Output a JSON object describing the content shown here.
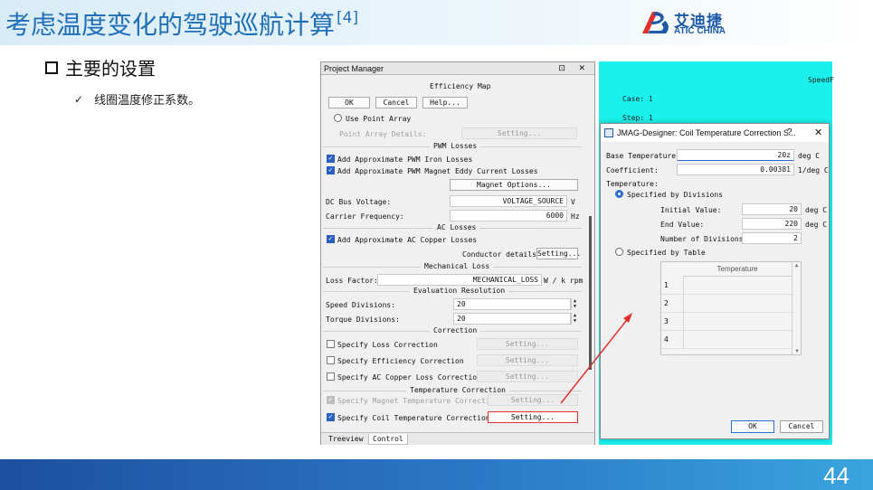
{
  "slide": {
    "title": "考虑温度变化的驾驶巡航计算",
    "title_ref": "[4]",
    "logo_cn": "艾迪捷",
    "logo_en": "ATIC CHINA",
    "heading": "主要的设置",
    "bullet": "线圈温度修正系数。",
    "page_number": "44"
  },
  "project_manager": {
    "title": "Project Manager",
    "window_controls": "⊡ ✕",
    "efficiency_map_label": "Efficiency Map",
    "ok": "OK",
    "cancel": "Cancel",
    "help": "Help...",
    "use_point_array": "Use Point Array",
    "point_array_details": "Point Array Details:",
    "setting": "Setting...",
    "pwm_losses": "PWM Losses",
    "pwm_iron": "Add Approximate PWM Iron Losses",
    "pwm_eddy": "Add Approximate PWM Magnet Eddy Current Losses",
    "magnet_options": "Magnet Options...",
    "dc_bus_label": "DC Bus Voltage:",
    "dc_bus_value": "VOLTAGE_SOURCE",
    "dc_bus_unit": "V",
    "carrier_label": "Carrier Frequency:",
    "carrier_value": "6000",
    "carrier_unit": "Hz",
    "ac_losses": "AC Losses",
    "ac_copper": "Add Approximate AC Copper Losses",
    "conductor_details": "Conductor details:",
    "mechanical_loss": "Mechanical Loss",
    "loss_factor_label": "Loss Factor:",
    "loss_factor_value": "MECHANICAL_LOSS",
    "loss_factor_unit": "W / k rpm",
    "eval_resolution": "Evaluation Resolution",
    "speed_div_label": "Speed Divisions:",
    "speed_div_value": "20",
    "torque_div_label": "Torque Divisions:",
    "torque_div_value": "20",
    "correction": "Correction",
    "loss_corr": "Specify Loss Correction",
    "eff_corr": "Specify Efficiency Correction",
    "ac_corr": "Specify AC Copper Loss Correction",
    "temp_correction": "Temperature Correction",
    "magnet_temp_corr": "Specify Magnet Temperature Correction",
    "coil_temp_corr": "Specify Coil Temperature Correction",
    "tab_treeview": "Treeview",
    "tab_control": "Control"
  },
  "background_panel": {
    "speed": "SpeedF",
    "case": "Case: 1",
    "step": "Step: 1"
  },
  "dialog": {
    "title": "JMAG-Designer: Coil Temperature Correction S...",
    "help_glyph": "?",
    "close_glyph": "✕",
    "base_temp_label": "Base Temperature:",
    "base_temp_value": "20z",
    "base_temp_unit": "deg C",
    "coefficient_label": "Coefficient:",
    "coefficient_value": "0.00381",
    "coefficient_unit": "1/deg C",
    "temperature_label": "Temperature:",
    "by_divisions": "Specified by Divisions",
    "initial_label": "Initial Value:",
    "initial_value": "20",
    "initial_unit": "deg C",
    "end_label": "End Value:",
    "end_value": "220",
    "end_unit": "deg C",
    "num_div_label": "Number of Divisions:",
    "num_div_value": "2",
    "by_table": "Specified by Table",
    "table_header": "Temperature",
    "rows": [
      "1",
      "2",
      "3",
      "4"
    ],
    "ok": "OK",
    "cancel": "Cancel"
  },
  "colors": {
    "title_blue": "#1f6fb8",
    "highlight_red": "#e0302c",
    "cyan_bg": "#1bf0ec",
    "checkbox_blue": "#2a5fbf"
  }
}
